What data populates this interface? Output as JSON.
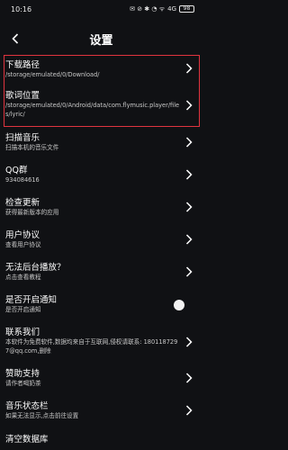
{
  "status_bar": {
    "time": "10:16",
    "icons_text": "✉ ⊘ ✱ ◔ ᯤ",
    "net": "4G",
    "battery": "98"
  },
  "header": {
    "title": "设置"
  },
  "settings": [
    {
      "label": "下载路径",
      "sub": "/storage/emulated/0/Download/"
    },
    {
      "label": "歌词位置",
      "sub": "/storage/emulated/0/Android/data/com.flymusic.player/files/lyric/"
    },
    {
      "label": "扫描音乐",
      "sub": "扫描本机的音乐文件"
    },
    {
      "label": "QQ群",
      "sub": "934084616"
    },
    {
      "label": "检查更新",
      "sub": "获得最新版本的应用"
    },
    {
      "label": "用户协议",
      "sub": "查看用户协议"
    },
    {
      "label": "无法后台播放？",
      "sub": "点击查看教程"
    },
    {
      "label": "是否开启通知",
      "sub": "是否开启通知",
      "toggle": true
    },
    {
      "label": "联系我们",
      "sub": "本软件为免费软件,数据均来自于互联网,侵权请联系: 1801187297@qq.com,删除"
    },
    {
      "label": "赞助支持",
      "sub": "请作者喝奶茶"
    },
    {
      "label": "音乐状态栏",
      "sub": "如果无法显示,点击前往设置"
    },
    {
      "label": "清空数据库",
      "sub": ""
    }
  ],
  "colors": {
    "background": "#101114",
    "highlight": "#e0343f",
    "subtext": "#c9c9c9"
  }
}
